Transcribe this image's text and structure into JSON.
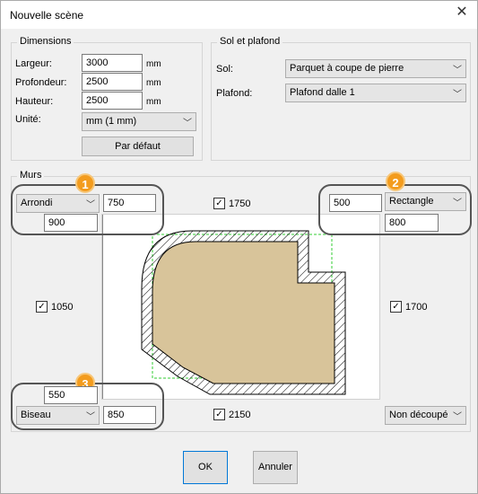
{
  "window": {
    "title": "Nouvelle scène",
    "close_label": "✕"
  },
  "dimensions": {
    "legend": "Dimensions",
    "largeur_label": "Largeur:",
    "largeur_value": "3000",
    "profondeur_label": "Profondeur:",
    "profondeur_value": "2500",
    "hauteur_label": "Hauteur:",
    "hauteur_value": "2500",
    "unit": "mm",
    "unite_label": "Unité:",
    "unite_value": "mm (1 mm)",
    "default_button": "Par défaut"
  },
  "sol_plafond": {
    "legend": "Sol et plafond",
    "sol_label": "Sol:",
    "sol_value": "Parquet à coupe de pierre",
    "plafond_label": "Plafond:",
    "plafond_value": "Plafond dalle 1"
  },
  "murs": {
    "legend": "Murs",
    "top_left": {
      "type": "Arrondi",
      "value_a": "750",
      "value_b": "900",
      "badge": "1"
    },
    "top_right": {
      "type": "Rectangle",
      "value_a": "500",
      "value_b": "800",
      "badge": "2"
    },
    "bottom_left": {
      "type": "Biseau",
      "value_a": "550",
      "value_b": "850",
      "badge": "3"
    },
    "bottom_right": {
      "type": "Non découpé"
    },
    "top_wall": {
      "checked": "✓",
      "value": "1750"
    },
    "bottom_wall": {
      "checked": "✓",
      "value": "2150"
    },
    "left_wall": {
      "checked": "✓",
      "value": "1050"
    },
    "right_wall": {
      "checked": "✓",
      "value": "1700"
    }
  },
  "footer": {
    "ok": "OK",
    "cancel": "Annuler"
  },
  "colors": {
    "floor": "#d8c49a",
    "accent": "#f39c1e",
    "dashed": "#33cc33"
  }
}
